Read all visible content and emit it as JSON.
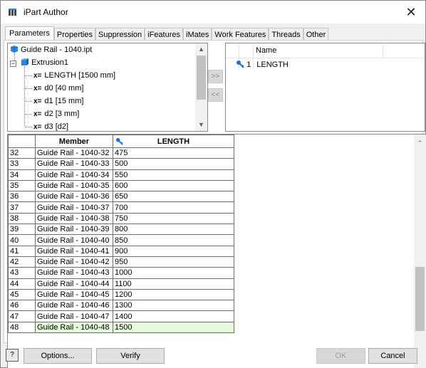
{
  "window": {
    "title": "iPart Author",
    "close_glyph": "✕"
  },
  "tabs": [
    {
      "label": "Parameters",
      "active": true
    },
    {
      "label": "Properties"
    },
    {
      "label": "Suppression"
    },
    {
      "label": "iFeatures"
    },
    {
      "label": "iMates"
    },
    {
      "label": "Work Features"
    },
    {
      "label": "Threads"
    },
    {
      "label": "Other"
    }
  ],
  "tree": {
    "root": "Guide Rail - 1040.ipt",
    "feature": "Extrusion1",
    "params_prefix": "x=",
    "params": [
      "LENGTH [1500 mm]",
      "d0 [40 mm]",
      "d1 [15 mm]",
      "d2 [3 mm]",
      "d3 [d2]"
    ]
  },
  "move_buttons": {
    "add": ">>",
    "remove": "<<"
  },
  "keys": {
    "header": "Name",
    "items": [
      {
        "num": "1",
        "name": "LENGTH"
      }
    ]
  },
  "table": {
    "columns": [
      "Member",
      "LENGTH"
    ],
    "rows": [
      {
        "n": "32",
        "member": "Guide Rail - 1040-32",
        "length": "475"
      },
      {
        "n": "33",
        "member": "Guide Rail - 1040-33",
        "length": "500"
      },
      {
        "n": "34",
        "member": "Guide Rail - 1040-34",
        "length": "550"
      },
      {
        "n": "35",
        "member": "Guide Rail - 1040-35",
        "length": "600"
      },
      {
        "n": "36",
        "member": "Guide Rail - 1040-36",
        "length": "650"
      },
      {
        "n": "37",
        "member": "Guide Rail - 1040-37",
        "length": "700"
      },
      {
        "n": "38",
        "member": "Guide Rail - 1040-38",
        "length": "750"
      },
      {
        "n": "39",
        "member": "Guide Rail - 1040-39",
        "length": "800"
      },
      {
        "n": "40",
        "member": "Guide Rail - 1040-40",
        "length": "850"
      },
      {
        "n": "41",
        "member": "Guide Rail - 1040-41",
        "length": "900"
      },
      {
        "n": "42",
        "member": "Guide Rail - 1040-42",
        "length": "950"
      },
      {
        "n": "43",
        "member": "Guide Rail - 1040-43",
        "length": "1000"
      },
      {
        "n": "44",
        "member": "Guide Rail - 1040-44",
        "length": "1100"
      },
      {
        "n": "45",
        "member": "Guide Rail - 1040-45",
        "length": "1200"
      },
      {
        "n": "46",
        "member": "Guide Rail - 1040-46",
        "length": "1300"
      },
      {
        "n": "47",
        "member": "Guide Rail - 1040-47",
        "length": "1400"
      },
      {
        "n": "48",
        "member": "Guide Rail - 1040-48",
        "length": "1500"
      }
    ]
  },
  "buttons": {
    "help": "?",
    "options": "Options...",
    "verify": "Verify",
    "ok": "OK",
    "cancel": "Cancel"
  },
  "colors": {
    "selected_row": "#e6fbd9",
    "key_icon": "#1e6fd0",
    "part_icon": "#2e86de"
  },
  "icons": {
    "title": "ipart-table-icon",
    "key": "key-icon",
    "part": "part-icon",
    "feature": "extrusion-icon"
  }
}
